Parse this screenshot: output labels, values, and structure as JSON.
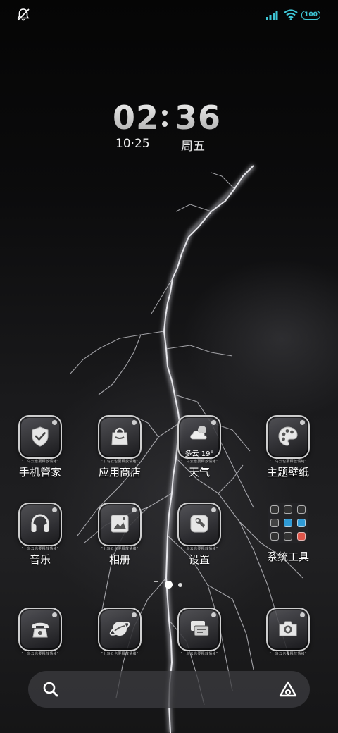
{
  "status_bar": {
    "battery": "100"
  },
  "clock": {
    "hour": "02",
    "minute": "36",
    "date": "10·25",
    "weekday": "周五"
  },
  "apps": [
    {
      "id": "security",
      "label": "手机管家",
      "tiny": "\"丨乌云也要释放情绪\""
    },
    {
      "id": "store",
      "label": "应用商店",
      "tiny": "\"丨乌云也要释放情绪\""
    },
    {
      "id": "weather",
      "label": "天气",
      "tiny": "\"丨乌云也要释放情绪\"",
      "weather": "多云 19°"
    },
    {
      "id": "themes",
      "label": "主题壁纸",
      "tiny": "\"丨乌云也要释放情绪\""
    },
    {
      "id": "music",
      "label": "音乐",
      "tiny": "\"丨乌云也要释放情绪\""
    },
    {
      "id": "gallery",
      "label": "相册",
      "tiny": "\"丨乌云也要释放情绪\""
    },
    {
      "id": "settings",
      "label": "设置",
      "tiny": "\"丨乌云也要释放情绪\""
    },
    {
      "id": "tools",
      "label": "系统工具"
    }
  ],
  "dock": [
    {
      "id": "phone",
      "tiny": "\"丨乌云也要释放情绪\""
    },
    {
      "id": "browser",
      "tiny": "\"丨乌云也要释放情绪\""
    },
    {
      "id": "messages",
      "tiny": "\"丨乌云也要释放情绪\""
    },
    {
      "id": "camera",
      "tiny": "\"丨乌云也要释放情绪\""
    }
  ],
  "icons": {
    "status": [
      "mute-icon",
      "signal-icon",
      "wifi-icon",
      "battery-icon"
    ],
    "search_bar": [
      "search-icon",
      "assistant-icon"
    ]
  },
  "colors": {
    "battery": "#3ec6d6",
    "folder_accents": [
      "#2f9bd6",
      "#e0564a"
    ]
  }
}
